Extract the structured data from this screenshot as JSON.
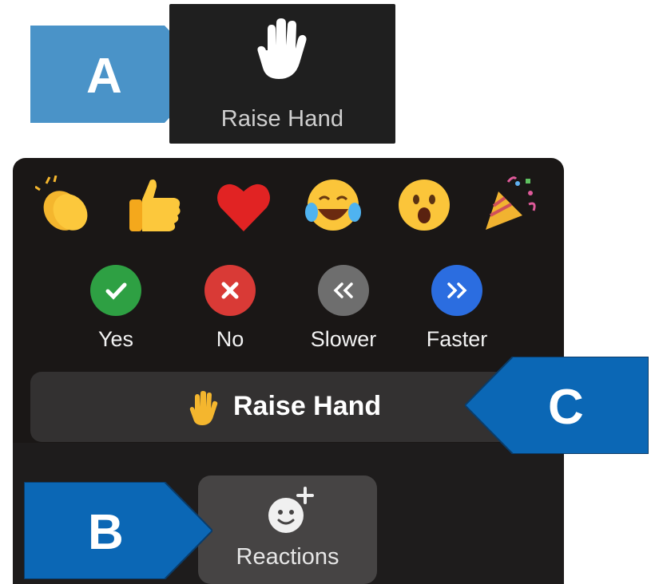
{
  "toolbar": {
    "raise_hand_label": "Raise Hand",
    "raise_hand_icon": "raised-hand-icon"
  },
  "reactions_panel": {
    "emojis": [
      {
        "name": "clapping-hands",
        "icon": "clapping-hands-icon"
      },
      {
        "name": "thumbs-up",
        "icon": "thumbs-up-icon"
      },
      {
        "name": "heart",
        "icon": "heart-icon"
      },
      {
        "name": "tears-of-joy",
        "icon": "tears-of-joy-icon"
      },
      {
        "name": "surprised",
        "icon": "surprised-face-icon"
      },
      {
        "name": "party-popper",
        "icon": "party-popper-icon"
      }
    ],
    "feedback": [
      {
        "label": "Yes",
        "icon": "checkmark-icon",
        "color": "#2ea043"
      },
      {
        "label": "No",
        "icon": "x-icon",
        "color": "#d93a36"
      },
      {
        "label": "Slower",
        "icon": "double-chevron-left-icon",
        "color": "#6e6e6e"
      },
      {
        "label": "Faster",
        "icon": "double-chevron-right-icon",
        "color": "#2b6de0"
      }
    ],
    "raise_hand_label": "Raise Hand"
  },
  "reactions_button": {
    "label": "Reactions",
    "icon": "add-reaction-icon"
  },
  "callouts": {
    "a": "A",
    "b": "B",
    "c": "C",
    "color_light": "#4a93c8",
    "color_dark": "#0b67b5"
  }
}
